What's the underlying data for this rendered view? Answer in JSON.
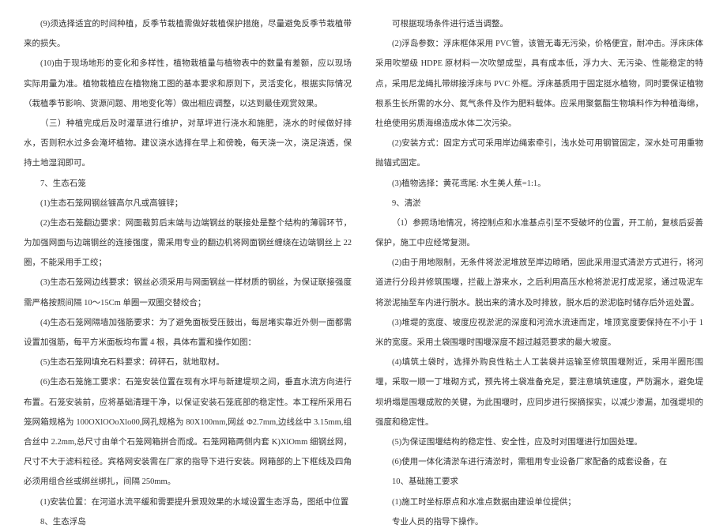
{
  "left": {
    "p1": "(9)须选择适宜的时间种植，反季节栽植需做好栽植保护措施，尽量避免反季节栽植带来的损失。",
    "p2": "(10)由于现场地形的变化和多样性，植物栽植量与植物表中的数量有差额，应以现场实际用量为准。植物栽植应在植物施工图的基本要求和原则下，灵活变化，根据实际情况（栽植季节影响、货源问题、用地变化等）做出相应调整，以达到最佳观赏效果。",
    "p3": "（三）种植完成后及时灌草进行维护，对草坪进行浇水和施肥，浇水的时候做好排水，否则积水过多会淹坏植物。建议浇水选择在早上和傍晚，每天浇一次，浇足浇透，保持土地湿润即可。",
    "p4": "7、生态石笼",
    "p5": "(1)生态石笼网钢丝镀高尔凡或高镀锌；",
    "p6": "(2)生态石笼翻边要求：网面裁剪后末端与边端钢丝的联接处是整个结构的薄弱环节，为加强网面与边端钢丝的连接强度，需采用专业的翻边机将网面钢丝缠绕在边端钢丝上 22 圈，不能采用手工绞；",
    "p7": "(3)生态石笼网边线要求：钢丝必须采用与网面钢丝一样材质的钢丝，为保证联接强度需严格按照间隔 10～15Cm 单圈一双圈交替绞合；",
    "p8": "(4)生态石笼网隔墙加强筋要求：为了避免面板受压鼓出，每层堵实靠近外侧一面都需设置加强筋，每平方米面板均布置 4 根，具体布置和操作如图：",
    "p9": "(5)生态石笼网填充石料要求：碎砰石，就地取材。",
    "p10": "(6)生态石笼施工要求：石笼安装位置在现有水坪与新建堤坝之间，垂直水流方向进行布置。石笼安装前，应将基础清理干净，以保证安装石笼底部的稳定性。本工程所采用石笼网箱规格为 100OXlOOoXlo00,网孔规格为 80X100mm,网丝 Φ2.7mm,边线丝中 3.15mm,组合丝中 2.2mm,总尺寸由单个石笼网箱拼合而成。石笼网箱两侧内套 K)XlOmm 细钢丝网，尺寸不大于滤料粒径。宾格网安装需在厂家的指导下进行安装。网箱部的上下框线及四角必须用组合丝或绑丝绑扎，间隔 250mm。",
    "p11": "(1)安装位置：在河道水流平缓和需要提升景观效果的水域设置生态浮岛，图纸中位置",
    "p12": "8、生态浮岛"
  },
  "right": {
    "p1": "可根据现场条件进行适当调整。",
    "p2": "(2)浮岛参数：浮床框体采用 PVC管，该管无毒无污染，价格便宜，耐冲击。浮床床体采用吹塑级 HDPE 原材料一次吹塑成型，具有成本低，浮力大、无污染、性能稳定的特点，采用尼龙绳扎带绑接浮床与 PVC 外框。浮床基质用于固定挺水植物，同时要保证植物根系生长所需的水分、氮气条件及作为肥料载体。应采用聚氨酯生物填料作为种植海绵，杜绝使用劣质海绵造成水体二次污染。",
    "p3": "(2)安装方式：固定方式可采用岸边绳索牵引，浅水处可用钢管固定，深水处可用重物抛锚式固定。",
    "p4": "(3)植物选择：黄花鸢尾: 水生美人蕉=1:1。",
    "p5": "9、清淤",
    "p6": "（1）参照场地情况，将控制点和水准基点引至不受破坏的位置，开工前，复核后妥善保护，施工中应经常复测。",
    "p7": "(2)由于用地限制，无条件将淤泥堆放至岸边晾晒，固此采用湿式清淤方式进行，将河道进行分段并修筑围堰，拦截上游来水，之后利用高压水枪将淤泥打成泥浆，通过吸泥车将淤泥抽至车内进行脱水。脱出来的清水及时排放，脱水后的淤泥临时储存后外运处置。",
    "p8": "(3)堆堤的宽度、坡度应视淤泥的深度和河流水流速而定，堆顶宽度要保持在不小于 1 米的宽度。采用土袋围堰时围堰深度不超过越范要求的最大坡度。",
    "p9": "(4)填筑土袋时，选择外购良性粘土人工装袋并运输至修筑围堰附近，采用半圈形围堰，采取一顺一丁堆砌方式，预先将土袋准备充足，要注意填筑速度，严防漏水，避免堤坝坍塌是围堰成败的关键，为此围堰时，应同步进行探摘探实，以减少渗漏，加强堤坝的强度和稳定性。",
    "p10": "(5)为保证围堰结构的稳定性、安全性，应及时对围堰进行加固处理。",
    "p11": "(6)使用一体化清淤车进行清淤时，需租用专业设备厂家配备的成套设备，在",
    "p12": "10、基础施工要求",
    "p13": "(1)施工时坐标原点和水准点数据由建设单位提供；",
    "p14": "专业人员的指导下操作。"
  }
}
